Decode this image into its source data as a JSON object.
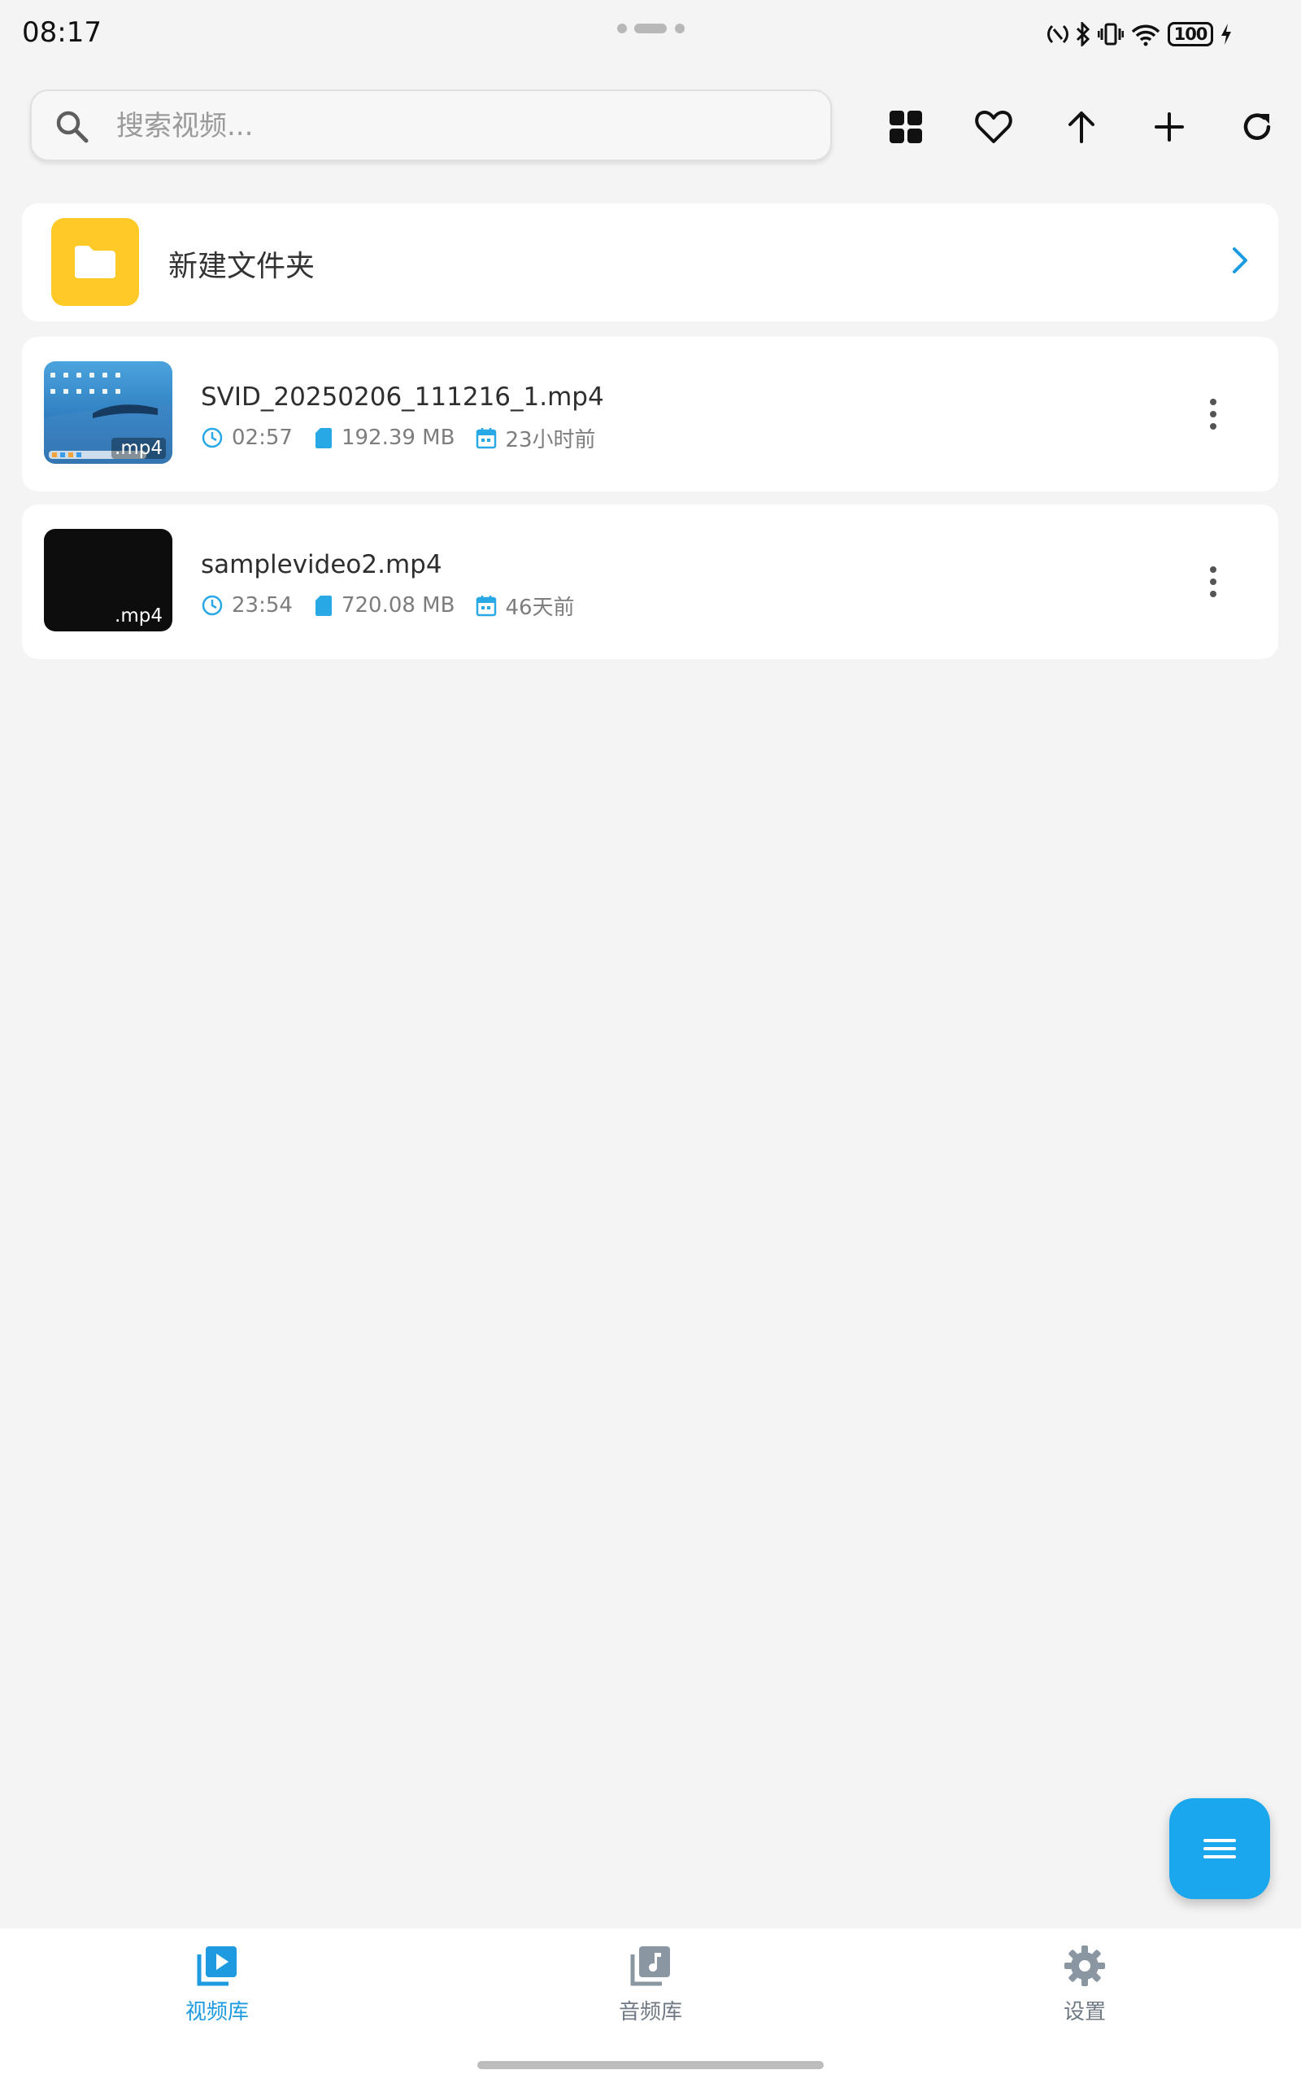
{
  "status_bar": {
    "time": "08:17",
    "battery": "100",
    "icons": [
      "nfc-icon",
      "bluetooth-icon",
      "vibrate-icon",
      "wifi-icon",
      "battery-icon",
      "charging-icon"
    ]
  },
  "search": {
    "placeholder": "搜索视频..."
  },
  "toolbar": {
    "buttons": [
      "grid-view-icon",
      "favorite-icon",
      "sort-up-icon",
      "add-icon",
      "refresh-icon"
    ]
  },
  "folder": {
    "label": "新建文件夹"
  },
  "videos": [
    {
      "title": "SVID_20250206_111216_1.mp4",
      "duration": "02:57",
      "size": "192.39 MB",
      "date": "23小时前",
      "ext": ".mp4"
    },
    {
      "title": "samplevideo2.mp4",
      "duration": "23:54",
      "size": "720.08 MB",
      "date": "46天前",
      "ext": ".mp4"
    }
  ],
  "bottom_nav": {
    "items": [
      {
        "label": "视频库",
        "active": true
      },
      {
        "label": "音频库",
        "active": false
      },
      {
        "label": "设置",
        "active": false
      }
    ]
  },
  "colors": {
    "accent": "#1aa7ee",
    "folder": "#ffc928",
    "meta_icon": "#29a8e6",
    "background": "#f4f4f4",
    "inactive_nav": "#8a97a3"
  }
}
